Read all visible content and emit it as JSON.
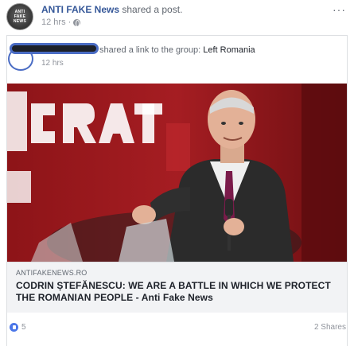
{
  "post": {
    "page_name": "ANTI FAKE News",
    "action": " shared a post.",
    "time": "12 hrs",
    "separator": "·",
    "avatar_label": "ANTI FAKE NEWS",
    "more_label": "···"
  },
  "shared": {
    "action": "shared a link to the group: ",
    "group_name": "Left Romania",
    "time": "12 hrs"
  },
  "link": {
    "image_name": "photo of man speaking at microphone",
    "domain": "ANTIFAKENEWS.RO",
    "title": "CODRIN ȘTEFĂNESCU: WE ARE A BATTLE IN WHICH WE PROTECT THE ROMANIAN PEOPLE - Anti Fake News"
  },
  "footer": {
    "reaction_icon": "like-icon",
    "reaction_count": "5",
    "shares": "2 Shares"
  },
  "colors": {
    "link_blue": "#365899",
    "meta_gray": "#90949c",
    "like_blue": "#4a76e8",
    "background_red": "#9c1b1f"
  }
}
